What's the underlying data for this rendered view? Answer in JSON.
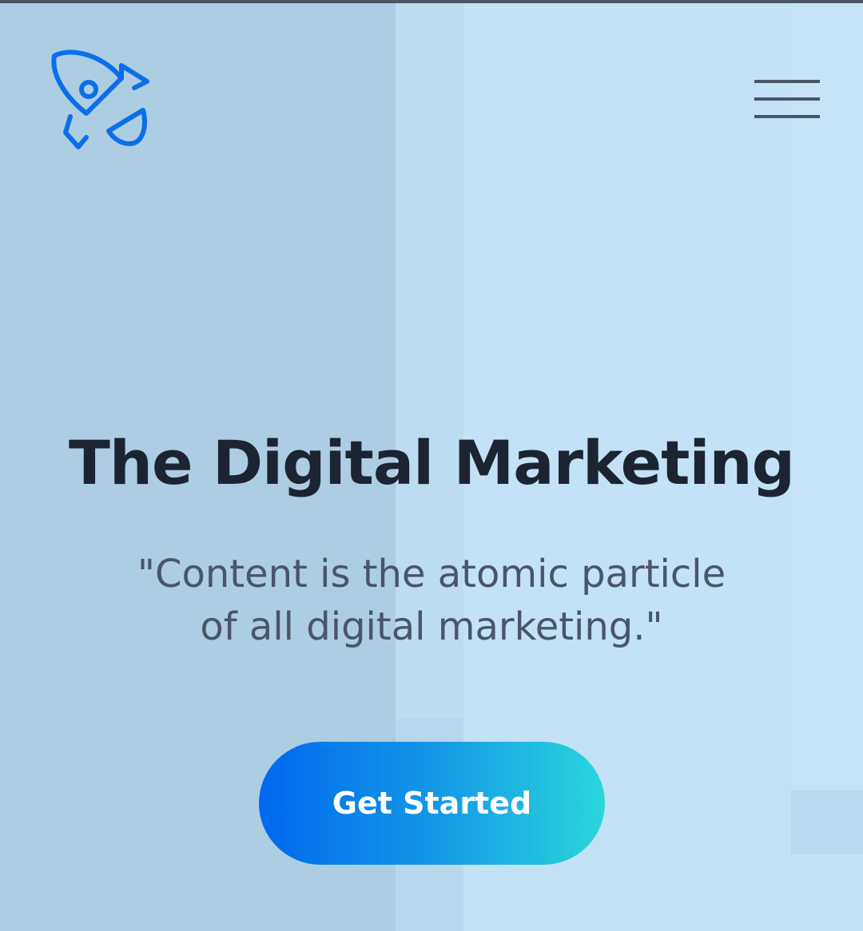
{
  "header": {
    "logo_icon": "rocket-icon",
    "menu_icon": "hamburger-menu-icon"
  },
  "hero": {
    "title": "The Digital Marketing",
    "quote_line1": "\"Content is the atomic particle",
    "quote_line2": "of all digital marketing.\"",
    "cta_label": "Get Started"
  },
  "colors": {
    "brand_blue": "#0a6fe8",
    "title": "#1c2431",
    "quote": "#4a5568",
    "menu_bars": "#4a5566",
    "cta_gradient_start": "#0068ee",
    "cta_gradient_end": "#2ad6dc",
    "background": "#bfdcef"
  }
}
